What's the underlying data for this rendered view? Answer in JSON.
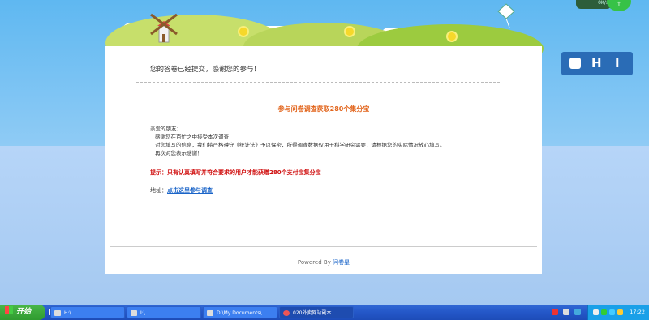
{
  "page": {
    "confirmation": "您的答卷已经提交，感谢您的参与！",
    "title": "参与问卷调查获取280个集分宝",
    "greeting": "亲爱的朋友：",
    "lines": [
      "感谢您在百忙之中接受本次调查！",
      "对您填写的信息，我们将严格遵守《统计法》予以保密，所得调查数据仅用于科学研究需要，请根据您的实际情况放心填写。",
      "再次对您表示感谢！"
    ],
    "tip": "提示：只有认真填写并符合要求的用户才能获赠280个支付宝集分宝",
    "address_label": "地址：",
    "address_link": "点击这里参与调查",
    "powered_prefix": "Powered By ",
    "powered_link": "问卷星"
  },
  "widget": {
    "h": "H",
    "i": "I"
  },
  "network": {
    "speed": "0K/s"
  },
  "taskbar": {
    "start": "开始",
    "tasks": [
      "H:\\",
      "I:\\",
      "D:\\My Documents\\...",
      "020外卖网站副本"
    ],
    "clock": "17:22"
  },
  "colors": {
    "accent": "#e2661e",
    "tip": "#d01010",
    "link": "#1a64c8"
  }
}
